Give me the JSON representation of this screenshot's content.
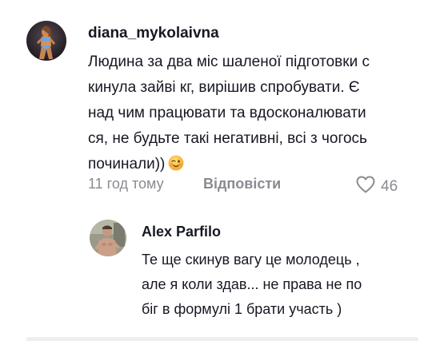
{
  "comments": [
    {
      "username": "diana_mykolaivna",
      "text_lines": [
        "Людина за два міс шаленої підготовки с",
        "кинула зайві кг, вирішив спробувати. Є",
        "над чим працювати та вдосконалювати",
        "ся, не будьте такі негативні, всі з чогось",
        "починали))"
      ],
      "emoji": "winking-face-emoji",
      "time": "11 год тому",
      "reply_label": "Відповісти",
      "like_count": "46",
      "like_icon": "heart-outline-icon"
    },
    {
      "username": "Alex Parfilo",
      "text_lines": [
        "Те ще скинув вагу це молодець ,",
        "але я коли здав... не права не по",
        "біг в формулі 1 брати участь )"
      ]
    }
  ],
  "colors": {
    "primary_text": "#161823",
    "secondary_text": "#8a8b91",
    "background": "#ffffff"
  }
}
